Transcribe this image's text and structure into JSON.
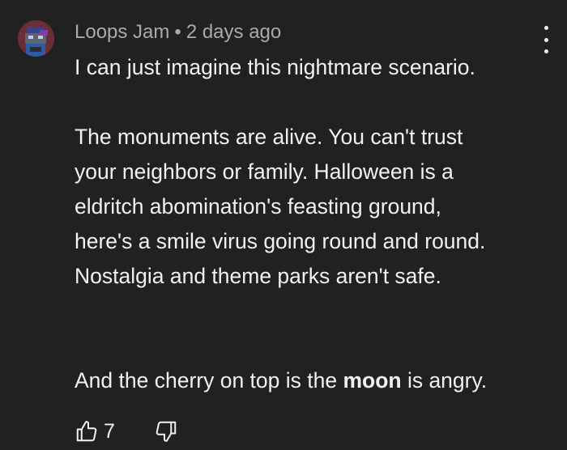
{
  "comment": {
    "author": "Loops Jam",
    "separator": "•",
    "time": "2 days ago",
    "lines": [
      "I can just imagine this nightmare scenario.",
      "The monuments are alive. You can't trust",
      "your neighbors or family. Halloween is a",
      "eldritch abomination's feasting ground,",
      "here's a smile virus going round and round.",
      "Nostalgia and theme parks aren't safe."
    ],
    "last_line": {
      "before": "And the cherry on top is the ",
      "bold": "moon",
      "after": " is angry."
    },
    "like_count": "7"
  },
  "icons": {
    "avatar": "avatar-icon",
    "more": "more-vertical-icon",
    "like": "thumbs-up-icon",
    "dislike": "thumbs-down-icon"
  },
  "colors": {
    "background": "#212121",
    "text": "#f1f1f1",
    "meta_text": "#aaaaaa",
    "avatar_bg": "#6a2f36"
  }
}
